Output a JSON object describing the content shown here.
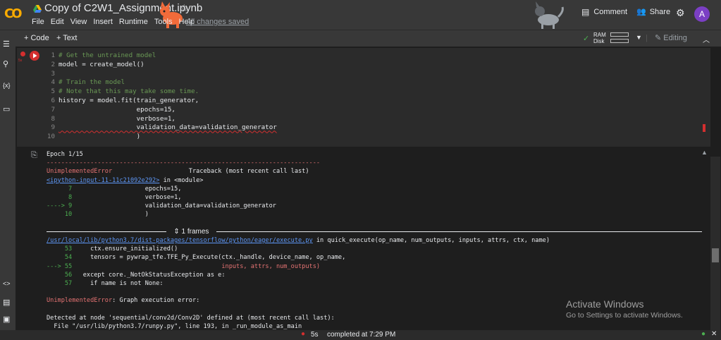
{
  "header": {
    "logo": "CO",
    "title": "Copy of C2W1_Assignment.ipynb",
    "menu": [
      "File",
      "Edit",
      "View",
      "Insert",
      "Runtime",
      "Tools",
      "Help"
    ],
    "save_status": "All changes saved",
    "comment": "Comment",
    "share": "Share",
    "avatar": "A"
  },
  "toolbar": {
    "add_code": "+ Code",
    "add_text": "+ Text",
    "ram": "RAM",
    "disk": "Disk",
    "mode": "Editing"
  },
  "cell": {
    "code_lines": [
      {
        "n": "1",
        "t": "# Get the untrained model",
        "cls": "cm"
      },
      {
        "n": "2",
        "t": "model = create_model()",
        "cls": ""
      },
      {
        "n": "3",
        "t": "",
        "cls": ""
      },
      {
        "n": "4",
        "t": "# Train the model",
        "cls": "cm"
      },
      {
        "n": "5",
        "t": "# Note that this may take some time.",
        "cls": "cm"
      },
      {
        "n": "6",
        "t": "history = model.fit(train_generator,",
        "cls": ""
      },
      {
        "n": "7",
        "t": "                    epochs=15,",
        "cls": ""
      },
      {
        "n": "8",
        "t": "                    verbose=1,",
        "cls": ""
      },
      {
        "n": "9",
        "t": "                    validation_data=validation_generator",
        "cls": ""
      },
      {
        "n": "10",
        "t": "                    )",
        "cls": ""
      }
    ]
  },
  "output": {
    "epoch": "Epoch 1/15",
    "dashes": "---------------------------------------------------------------------------",
    "error_name": "UnimplementedError",
    "traceback": "Traceback (most recent call last)",
    "input_link": "<ipython-input-11-11c21092e292>",
    "in_module": " in <module>",
    "tb1": [
      "      7",
      "      8",
      "----> 9",
      "     10"
    ],
    "tb1_code": [
      "                    epochs=15,",
      "                    verbose=1,",
      "                    validation_data=validation_generator",
      "                    )"
    ],
    "frames": "1 frames",
    "exec_link": "/usr/local/lib/python3.7/dist-packages/tensorflow/python/eager/execute.py",
    "exec_in": " in quick_execute(op_name, num_outputs, inputs, attrs, ctx, name)",
    "tb2_nums": [
      "     53",
      "     54",
      "---> 55",
      "     56",
      "     57"
    ],
    "tb2_code": [
      "     ctx.ensure_initialized()",
      "     tensors = pywrap_tfe.TFE_Py_Execute(ctx._handle, device_name, op_name,",
      "                                         inputs, attrs, num_outputs)",
      "   except core._NotOkStatusException as e:",
      "     if name is not None:"
    ],
    "final_error": "UnimplementedError",
    "final_msg": ": Graph execution error:",
    "detected": "Detected at node 'sequential/conv2d/Conv2D' defined at (most recent call last):",
    "file_line": "  File \"/usr/lib/python3.7/runpy.py\", line 193, in _run_module_as_main"
  },
  "watermark": {
    "title": "Activate Windows",
    "sub": "Go to Settings to activate Windows."
  },
  "status": {
    "duration": "5s",
    "completed": "completed at 7:29 PM"
  },
  "colors": {
    "accent": "#f9ab00",
    "error": "#d32f2f",
    "avatar": "#7b3fc4"
  }
}
